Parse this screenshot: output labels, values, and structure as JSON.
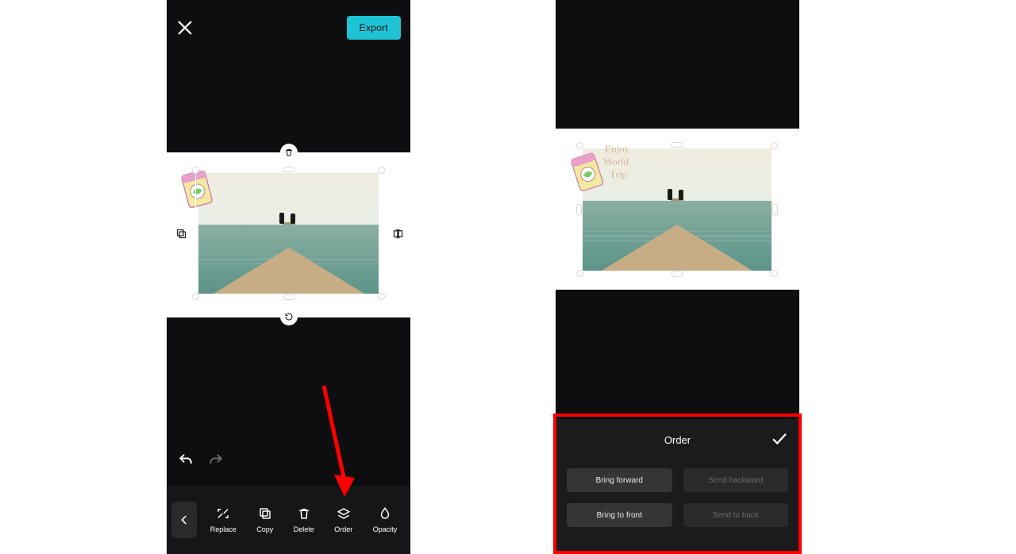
{
  "left": {
    "header": {
      "export_label": "Export"
    },
    "toolbar": {
      "items": [
        {
          "label": "Replace"
        },
        {
          "label": "Copy"
        },
        {
          "label": "Delete"
        },
        {
          "label": "Order"
        },
        {
          "label": "Opacity"
        }
      ]
    }
  },
  "right": {
    "order_panel": {
      "title": "Order",
      "buttons": {
        "bring_forward": "Bring forward",
        "send_backward": "Send backward",
        "bring_to_front": "Bring to front",
        "send_to_back": "Send to back"
      }
    }
  },
  "colors": {
    "accent": "#1ec4d6",
    "annotation": "#ff0000"
  }
}
